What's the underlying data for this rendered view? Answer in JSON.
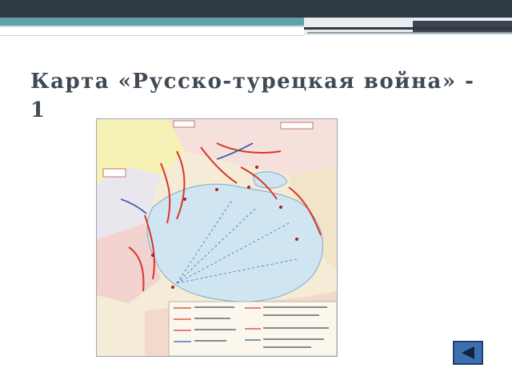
{
  "slide": {
    "title": "Карта «Русско-турецкая война» - 1"
  },
  "map": {
    "description_icon": "historical-war-map",
    "sea_color": "#cfe6f2",
    "land_color": "#f2e7d0",
    "front_color": "#d9352b",
    "route_color": "#2c5aa8"
  },
  "navigation": {
    "back_icon": "left-triangle-icon",
    "button_color": "#3d6fb0"
  },
  "theme": {
    "header_dark": "#2f3a44",
    "header_accent": "#5fa3a8",
    "title_color": "#3f4a55"
  }
}
